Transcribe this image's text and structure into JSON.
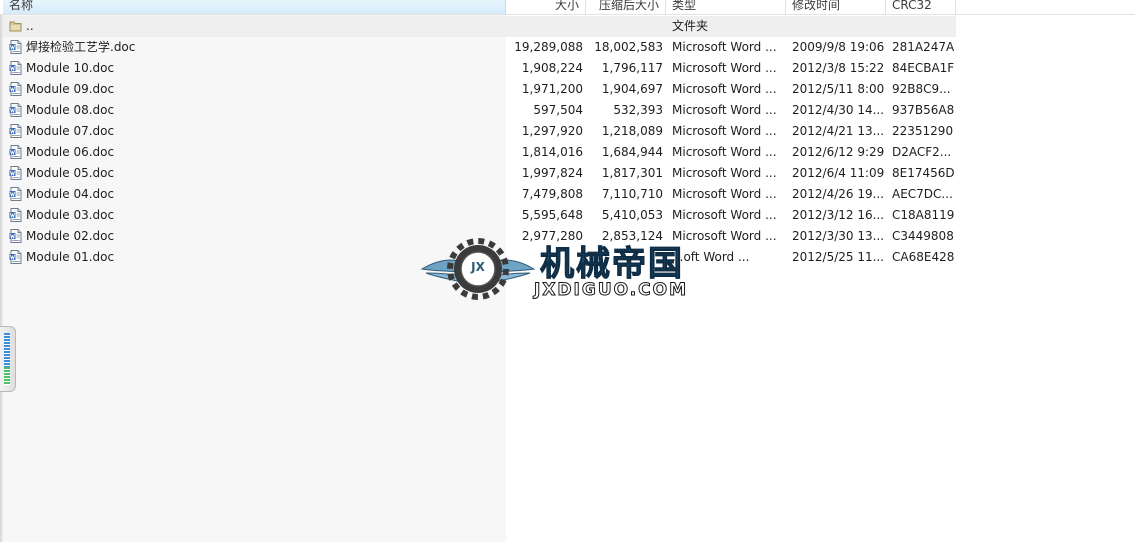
{
  "columns": {
    "name": "名称",
    "size": "大小",
    "packed": "压缩后大小",
    "type": "类型",
    "modified": "修改时间",
    "crc": "CRC32"
  },
  "parent_row": {
    "name": "..",
    "type": "文件夹"
  },
  "files": [
    {
      "name": "焊接检验工艺学.doc",
      "size": "19,289,088",
      "packed": "18,002,583",
      "type": "Microsoft Word ...",
      "modified": "2009/9/8 19:06",
      "crc": "281A247A"
    },
    {
      "name": "Module 10.doc",
      "size": "1,908,224",
      "packed": "1,796,117",
      "type": "Microsoft Word ...",
      "modified": "2012/3/8 15:22",
      "crc": "84ECBA1F"
    },
    {
      "name": "Module 09.doc",
      "size": "1,971,200",
      "packed": "1,904,697",
      "type": "Microsoft Word ...",
      "modified": "2012/5/11 8:00",
      "crc": "92B8C9..."
    },
    {
      "name": "Module 08.doc",
      "size": "597,504",
      "packed": "532,393",
      "type": "Microsoft Word ...",
      "modified": "2012/4/30 14...",
      "crc": "937B56A8"
    },
    {
      "name": "Module 07.doc",
      "size": "1,297,920",
      "packed": "1,218,089",
      "type": "Microsoft Word ...",
      "modified": "2012/4/21 13...",
      "crc": "22351290"
    },
    {
      "name": "Module 06.doc",
      "size": "1,814,016",
      "packed": "1,684,944",
      "type": "Microsoft Word ...",
      "modified": "2012/6/12 9:29",
      "crc": "D2ACF2..."
    },
    {
      "name": "Module 05.doc",
      "size": "1,997,824",
      "packed": "1,817,301",
      "type": "Microsoft Word ...",
      "modified": "2012/6/4 11:09",
      "crc": "8E17456D"
    },
    {
      "name": "Module 04.doc",
      "size": "7,479,808",
      "packed": "7,110,710",
      "type": "Microsoft Word ...",
      "modified": "2012/4/26 19...",
      "crc": "AEC7DC..."
    },
    {
      "name": "Module 03.doc",
      "size": "5,595,648",
      "packed": "5,410,053",
      "type": "Microsoft Word ...",
      "modified": "2012/3/12 16...",
      "crc": "C18A8119"
    },
    {
      "name": "Module 02.doc",
      "size": "2,977,280",
      "packed": "2,853,124",
      "type": "Microsoft Word ...",
      "modified": "2012/3/30 13...",
      "crc": "C3449808"
    },
    {
      "name": "Module 01.doc",
      "size": "",
      "packed": "",
      "type": "...oft Word ...",
      "modified": "2012/5/25 11...",
      "crc": "CA68E428"
    }
  ],
  "watermark": {
    "title": "机械帝国",
    "subtitle": "JXDIGUO.COM",
    "badge": "JX"
  },
  "colors": {
    "header_sorted": "#d6ecfb",
    "name_column_bg": "#f7f7f7",
    "watermark_blue": "#1d4f72"
  },
  "icons": {
    "parent": "folder-icon",
    "file": "word-document-icon"
  }
}
